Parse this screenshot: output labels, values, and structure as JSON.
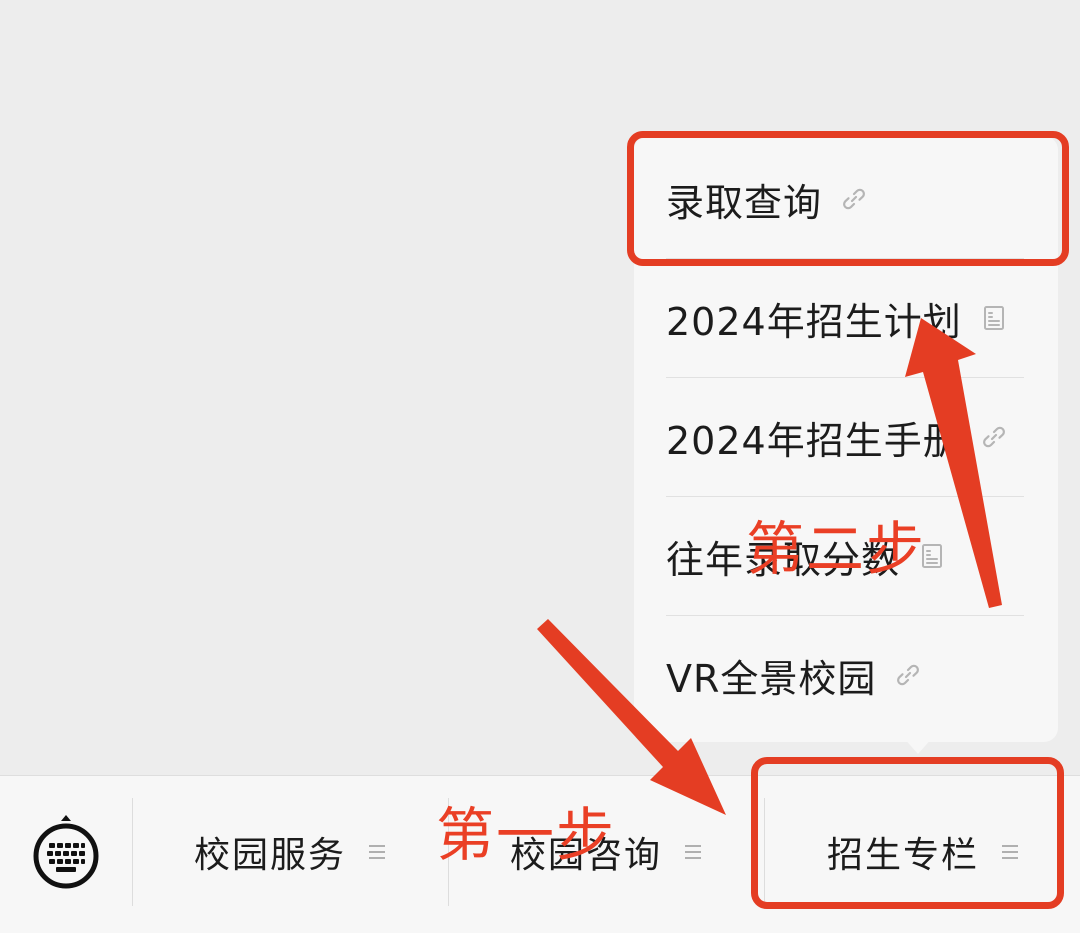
{
  "popup_menu": {
    "items": [
      {
        "label": "录取查询",
        "icon": "link-icon"
      },
      {
        "label": "2024年招生计划",
        "icon": "document-icon"
      },
      {
        "label": "2024年招生手册",
        "icon": "link-icon"
      },
      {
        "label": "往年录取分数",
        "icon": "document-icon"
      },
      {
        "label": "VR全景校园",
        "icon": "link-icon"
      }
    ]
  },
  "bottom_bar": {
    "keyboard_icon": "keyboard-icon",
    "tabs": [
      {
        "label": "校园服务",
        "icon": "menu-lines-icon"
      },
      {
        "label": "校园咨询",
        "icon": "menu-lines-icon"
      },
      {
        "label": "招生专栏",
        "icon": "menu-lines-icon"
      }
    ]
  },
  "annotations": {
    "step1": "第一步",
    "step2": "第二步",
    "color": "#e43d23"
  }
}
